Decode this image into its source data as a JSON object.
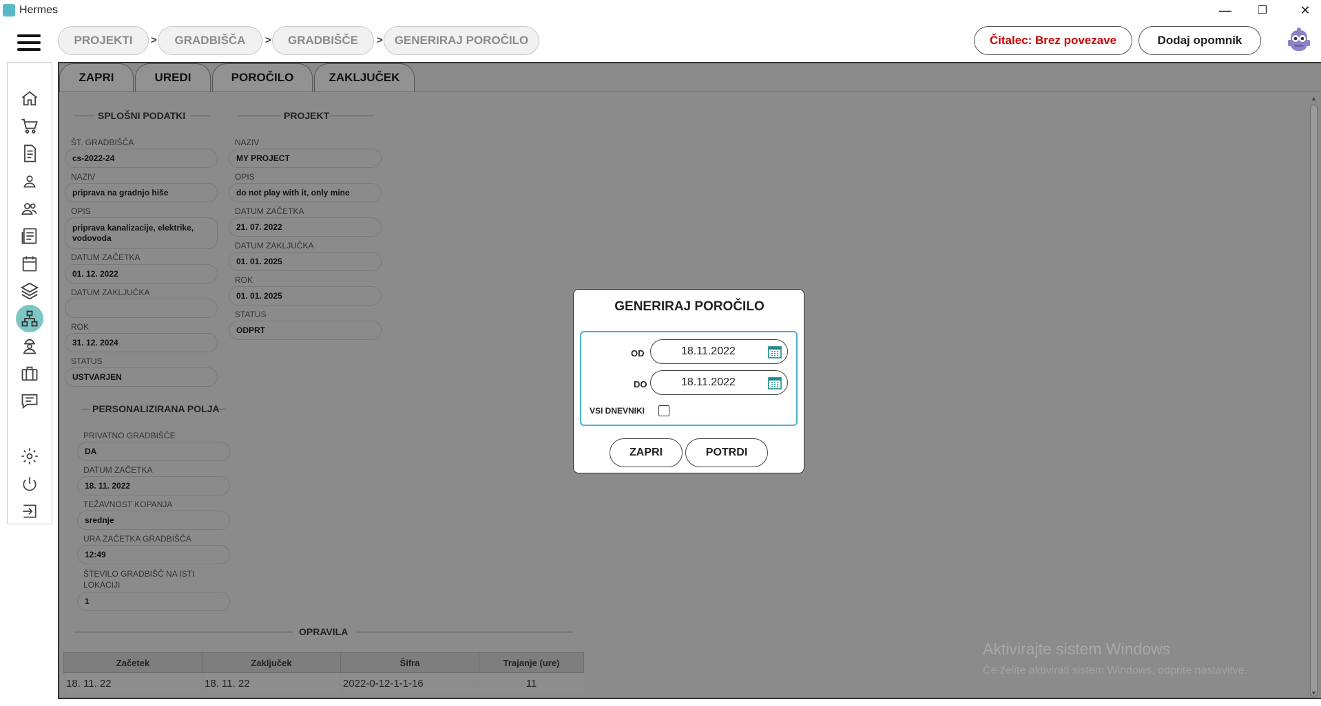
{
  "window": {
    "title": "Hermes",
    "min": "—",
    "restore": "❐",
    "close": "✕"
  },
  "breadcrumb": [
    "PROJEKTI",
    "GRADBIŠČA",
    "GRADBIŠČE",
    "GENERIRAJ POROČILO"
  ],
  "breadcrumb_sep": ">",
  "header": {
    "reader_status": "Čitalec: Brez povezave",
    "reader_color": "#cc0000",
    "add_reminder": "Dodaj opomnik"
  },
  "tabs": [
    "ZAPRI",
    "UREDI",
    "POROČILO",
    "ZAKLJUČEK"
  ],
  "general": {
    "title": "SPLOŠNI PODATKI",
    "fields": [
      {
        "label": "ŠT. GRADBIŠČA",
        "value": "cs-2022-24"
      },
      {
        "label": "NAZIV",
        "value": "priprava na gradnjo hiše"
      },
      {
        "label": "OPIS",
        "value": "priprava kanalizacije, elektrike, vodovoda"
      },
      {
        "label": "DATUM ZAČETKA",
        "value": "01. 12. 2022"
      },
      {
        "label": "DATUM ZAKLJUČKA",
        "value": ""
      },
      {
        "label": "ROK",
        "value": "31. 12. 2024"
      },
      {
        "label": "STATUS",
        "value": "USTVARJEN"
      }
    ]
  },
  "project": {
    "title": "PROJEKT",
    "fields": [
      {
        "label": "NAZIV",
        "value": "MY PROJECT"
      },
      {
        "label": "OPIS",
        "value": "do not play with it, only mine"
      },
      {
        "label": "DATUM ZAČETKA",
        "value": "21. 07. 2022"
      },
      {
        "label": "DATUM ZAKLJUČKA",
        "value": "01. 01. 2025"
      },
      {
        "label": "ROK",
        "value": "01. 01. 2025"
      },
      {
        "label": "STATUS",
        "value": "ODPRT"
      }
    ]
  },
  "custom": {
    "title": "PERSONALIZIRANA POLJA",
    "fields": [
      {
        "label": "PRIVATNO GRADBIŠČE",
        "value": "DA"
      },
      {
        "label": "DATUM ZAČETKA",
        "value": "18. 11. 2022"
      },
      {
        "label": "TEŽAVNOST KOPANJA",
        "value": "srednje"
      },
      {
        "label": "URA ZAČETKA GRADBIŠČA",
        "value": "12:49"
      },
      {
        "label": "ŠTEVILO GRADBIŠČ NA ISTI LOKACIJI",
        "value": "1"
      }
    ]
  },
  "tasks": {
    "title": "OPRAVILA",
    "columns": [
      "Začetek",
      "Zaključek",
      "Šifra",
      "Trajanje (ure)"
    ],
    "rows": [
      [
        "18. 11. 22",
        "18. 11. 22",
        "2022-0-12-1-1-16",
        "11"
      ]
    ]
  },
  "dialog": {
    "title": "GENERIRAJ POROČILO",
    "from_label": "OD",
    "from_value": "18.11.2022",
    "to_label": "DO",
    "to_value": "18.11.2022",
    "all_label": "VSI DNEVNIKI",
    "all_checked": false,
    "close": "ZAPRI",
    "confirm": "POTRDI"
  },
  "watermark": {
    "line1": "Aktivirajte sistem Windows",
    "line2": "Če želite aktivirati sistem Windows, odprite nastavitve."
  },
  "sidebar_icons": [
    "home-icon",
    "cart-icon",
    "document-icon",
    "user-icon",
    "users-icon",
    "news-icon",
    "calendar-icon",
    "layers-icon",
    "sitemap-icon",
    "worker-icon",
    "briefcase-icon",
    "chat-icon",
    "gear-icon",
    "power-icon",
    "logout-icon"
  ],
  "colors": {
    "accent": "#4ab0c8",
    "active_nav": "#7cc6c4",
    "overlay": "#8b8b8b",
    "calendar": "#1a8a8a"
  }
}
